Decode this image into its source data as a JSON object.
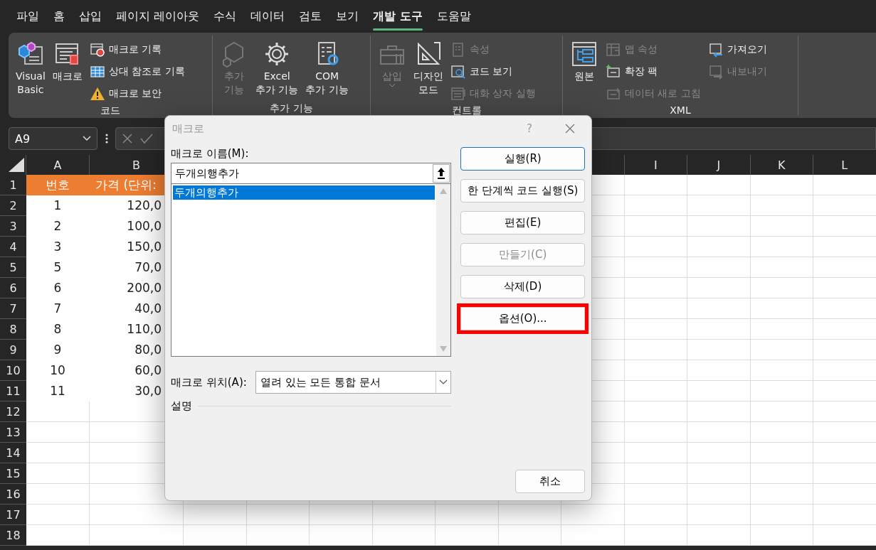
{
  "menu_tabs": [
    {
      "label": "파일",
      "selected": false
    },
    {
      "label": "홈",
      "selected": false
    },
    {
      "label": "삽입",
      "selected": false
    },
    {
      "label": "페이지 레이아웃",
      "selected": false
    },
    {
      "label": "수식",
      "selected": false
    },
    {
      "label": "데이터",
      "selected": false
    },
    {
      "label": "검토",
      "selected": false
    },
    {
      "label": "보기",
      "selected": false
    },
    {
      "label": "개발 도구",
      "selected": true
    },
    {
      "label": "도움말",
      "selected": false
    }
  ],
  "ribbon": {
    "groups": [
      {
        "title": "코드",
        "large": [
          {
            "label": "Visual\nBasic",
            "disabled": false
          },
          {
            "label": "매크로",
            "disabled": false
          }
        ],
        "small": [
          [
            {
              "label": "매크로 기록",
              "disabled": false
            },
            {
              "label": "상대 참조로 기록",
              "disabled": false
            },
            {
              "label": "매크로 보안",
              "disabled": false
            }
          ]
        ]
      },
      {
        "title": "추가 기능",
        "large": [
          {
            "label": "추가\n기능",
            "disabled": true
          },
          {
            "label": "Excel\n추가 기능",
            "disabled": false
          },
          {
            "label": "COM\n추가 기능",
            "disabled": false
          }
        ]
      },
      {
        "title": "컨트롤",
        "large": [
          {
            "label": "삽입",
            "disabled": true,
            "dropdown": true
          },
          {
            "label": "디자인\n모드",
            "disabled": false
          }
        ],
        "small": [
          [
            {
              "label": "속성",
              "disabled": true
            },
            {
              "label": "코드 보기",
              "disabled": false
            },
            {
              "label": "대화 상자 실행",
              "disabled": true
            }
          ]
        ]
      },
      {
        "title": "XML",
        "large": [
          {
            "label": "원본",
            "disabled": false
          }
        ],
        "small": [
          [
            {
              "label": "맵 속성",
              "disabled": true
            },
            {
              "label": "확장 팩",
              "disabled": false
            },
            {
              "label": "데이터 새로 고침",
              "disabled": true
            }
          ],
          [
            {
              "label": "가져오기",
              "disabled": false
            },
            {
              "label": "내보내기",
              "disabled": true
            }
          ]
        ]
      }
    ]
  },
  "name_box": "A9",
  "sheet": {
    "columns": [
      "A",
      "B",
      "I",
      "J",
      "K",
      "L"
    ],
    "rows": [
      {
        "header": "1",
        "kind": "title",
        "cells": [
          "번호",
          "가격 (단위:"
        ]
      },
      {
        "header": "2",
        "kind": "data",
        "cells": [
          "1",
          "120,0"
        ]
      },
      {
        "header": "3",
        "kind": "data",
        "cells": [
          "2",
          "100,0"
        ]
      },
      {
        "header": "4",
        "kind": "data",
        "cells": [
          "3",
          "150,0"
        ]
      },
      {
        "header": "5",
        "kind": "data",
        "cells": [
          "5",
          "70,0"
        ]
      },
      {
        "header": "6",
        "kind": "data",
        "cells": [
          "6",
          "200,0"
        ]
      },
      {
        "header": "7",
        "kind": "data",
        "cells": [
          "7",
          "40,0"
        ]
      },
      {
        "header": "8",
        "kind": "data",
        "cells": [
          "8",
          "110,0"
        ]
      },
      {
        "header": "9",
        "kind": "data",
        "cells": [
          "9",
          "80,0"
        ]
      },
      {
        "header": "10",
        "kind": "data",
        "cells": [
          "10",
          "60,0"
        ]
      },
      {
        "header": "11",
        "kind": "data",
        "cells": [
          "11",
          "30,0"
        ]
      },
      {
        "header": "12",
        "kind": "empty"
      },
      {
        "header": "13",
        "kind": "empty"
      },
      {
        "header": "14",
        "kind": "empty"
      },
      {
        "header": "15",
        "kind": "empty"
      },
      {
        "header": "16",
        "kind": "empty"
      },
      {
        "header": "17",
        "kind": "empty"
      },
      {
        "header": "18",
        "kind": "empty"
      }
    ]
  },
  "dialog": {
    "title": "매크로",
    "help": "?",
    "name_label": "매크로 이름(M):",
    "name_value": "두개의행추가",
    "macros": [
      {
        "label": "두개의행추가",
        "selected": true
      }
    ],
    "location_label": "매크로 위치(A):",
    "location_value": "열려 있는 모든 통합 문서",
    "description_label": "설명",
    "buttons": [
      {
        "label": "실행(R)",
        "default": true,
        "disabled": false,
        "highlighted": false
      },
      {
        "label": "한 단계씩 코드 실행(S)",
        "default": false,
        "disabled": false,
        "highlighted": false
      },
      {
        "label": "편집(E)",
        "default": false,
        "disabled": false,
        "highlighted": false
      },
      {
        "label": "만들기(C)",
        "default": false,
        "disabled": true,
        "highlighted": false
      },
      {
        "label": "삭제(D)",
        "default": false,
        "disabled": false,
        "highlighted": false
      },
      {
        "label": "옵션(O)...",
        "default": false,
        "disabled": false,
        "highlighted": true
      }
    ],
    "cancel": "취소"
  }
}
